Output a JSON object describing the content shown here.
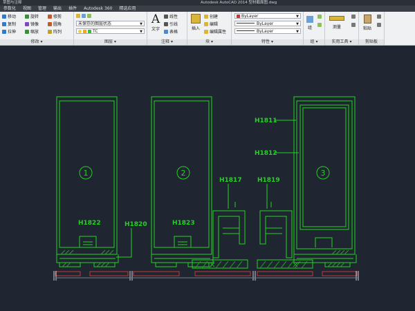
{
  "titlebar": {
    "quick_access": "草图与注释",
    "title": "Autodesk AutoCAD 2014   型材截面图.dwg"
  },
  "tabs": [
    "参数化",
    "视图",
    "管理",
    "输出",
    "插件",
    "Autodesk 360",
    "精选应用"
  ],
  "panels": {
    "modify": {
      "title": "修改 ▾",
      "items": [
        "移动",
        "旋转",
        "修剪",
        "复制",
        "镜像",
        "圆角",
        "拉伸",
        "缩放",
        "阵列"
      ]
    },
    "layers": {
      "title": "图层 ▾",
      "state": "未保存的图层状态",
      "current": "TC"
    },
    "annotation": {
      "title": "注释 ▾",
      "text": "文字",
      "linear": "线性",
      "leader": "引线",
      "table": "表格"
    },
    "block": {
      "title": "块 ▾",
      "insert": "插入",
      "create": "创建",
      "edit": "编辑",
      "edit_attr": "编辑属性"
    },
    "properties": {
      "title": "特性 ▾",
      "color": "ByLayer",
      "linetype": "ByLayer",
      "lineweight": "ByLayer"
    },
    "groups": {
      "title": "组 ▾",
      "group": "组"
    },
    "utilities": {
      "title": "实用工具 ▾",
      "measure": "测量"
    },
    "clipboard": {
      "title": "剪贴板",
      "paste": "粘贴"
    }
  },
  "drawing": {
    "labels": {
      "h1811": "H1811",
      "h1812": "H1812",
      "h1817": "H1817",
      "h1819": "H1819",
      "h1820": "H1820",
      "h1822": "H1822",
      "h1823": "H1823"
    },
    "circles": [
      "1",
      "2",
      "3"
    ]
  },
  "colors": {
    "cad_line": "#22d420",
    "canvas_bg": "#1f2631",
    "dim_red": "#c43a3a"
  }
}
